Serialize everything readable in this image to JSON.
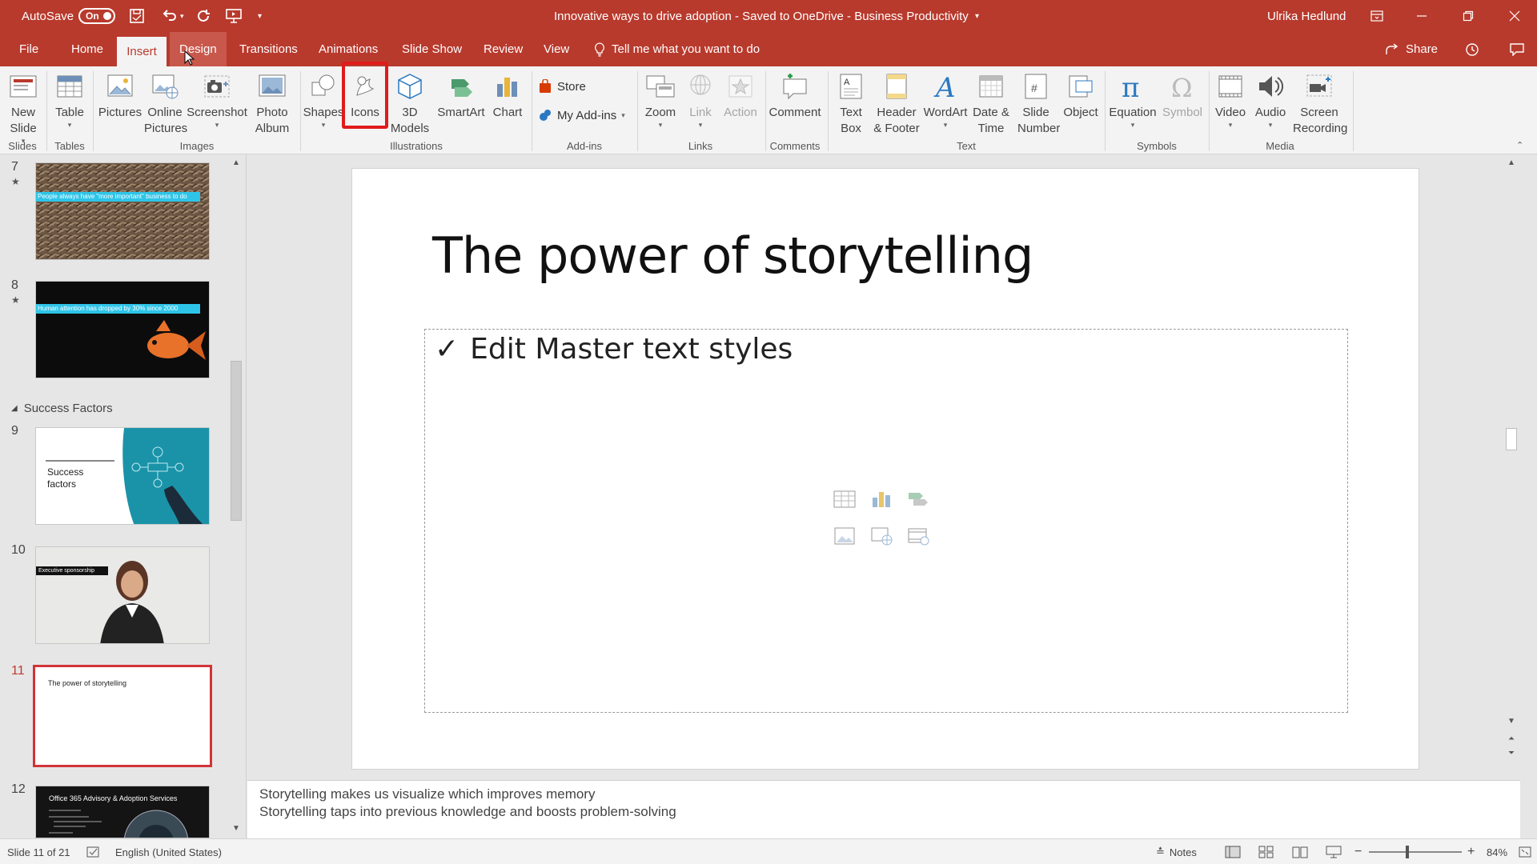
{
  "titlebar": {
    "autosave_label": "AutoSave",
    "autosave_state": "On",
    "doc_title": "Innovative ways to drive adoption  -  Saved to OneDrive - Business Productivity",
    "user": "Ulrika Hedlund"
  },
  "tabs": [
    "File",
    "Home",
    "Insert",
    "Design",
    "Transitions",
    "Animations",
    "Slide Show",
    "Review",
    "View"
  ],
  "tell_me": "Tell me what you want to do",
  "share": "Share",
  "ribbon": {
    "new_slide": "New Slide",
    "table": "Table",
    "pictures": "Pictures",
    "online_pictures": "Online Pictures",
    "screenshot": "Screenshot",
    "photo_album": "Photo Album",
    "shapes": "Shapes",
    "icons": "Icons",
    "models_3d": "3D Models",
    "smartart": "SmartArt",
    "chart": "Chart",
    "store": "Store",
    "my_addins": "My Add-ins",
    "zoom": "Zoom",
    "link": "Link",
    "action": "Action",
    "comment": "Comment",
    "text_box": "Text Box",
    "header_footer": "Header & Footer",
    "wordart": "WordArt",
    "date_time": "Date & Time",
    "slide_number": "Slide Number",
    "object": "Object",
    "equation": "Equation",
    "symbol": "Symbol",
    "video": "Video",
    "audio": "Audio",
    "screen_recording": "Screen Recording",
    "groups": {
      "slides": "Slides",
      "tables": "Tables",
      "images": "Images",
      "illustrations": "Illustrations",
      "addins": "Add-ins",
      "links": "Links",
      "comments": "Comments",
      "text": "Text",
      "symbols": "Symbols",
      "media": "Media"
    }
  },
  "thumbnails": {
    "s7_num": "7",
    "s7_caption": "People always have \"more important\" business to do",
    "s8_num": "8",
    "s8_caption": "Human attention has dropped by 30% since 2000",
    "section": "Success Factors",
    "s9_num": "9",
    "s9_title": "Success factors",
    "s10_num": "10",
    "s10_caption": "Executive sponsorship",
    "s11_num": "11",
    "s11_title": "The power of storytelling",
    "s12_num": "12",
    "s12_title": "Office 365 Advisory & Adoption Services"
  },
  "slide": {
    "title": "The power of storytelling",
    "bullet": "Edit Master text styles",
    "check": "✓"
  },
  "notes": [
    "Storytelling makes us visualize which improves memory",
    "Storytelling taps into previous knowledge and boosts problem-solving"
  ],
  "status": {
    "slide_of": "Slide 11 of 21",
    "language": "English (United States)",
    "notes": "Notes",
    "zoom": "84%"
  },
  "colors": {
    "brand": "#b83a2d",
    "highlight": "#e01b1b",
    "selected_thumb": "#d13438"
  }
}
